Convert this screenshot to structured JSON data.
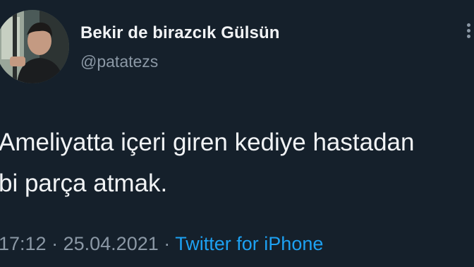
{
  "tweet": {
    "display_name": "Bekir de birazcık Gülsün",
    "handle": "@patatezs",
    "text_line1": "Ameliyatta içeri giren kediye hastadan",
    "text_line2": "bi parça atmak.",
    "time": "17:12",
    "separator1": "·",
    "date": "25.04.2021",
    "separator2": "·",
    "source": "Twitter for iPhone"
  },
  "colors": {
    "background": "#15202b",
    "text": "#f1f3f5",
    "secondary": "#8b98a5",
    "link": "#1da1f2"
  },
  "icons": {
    "more": "more-vertical-icon"
  }
}
